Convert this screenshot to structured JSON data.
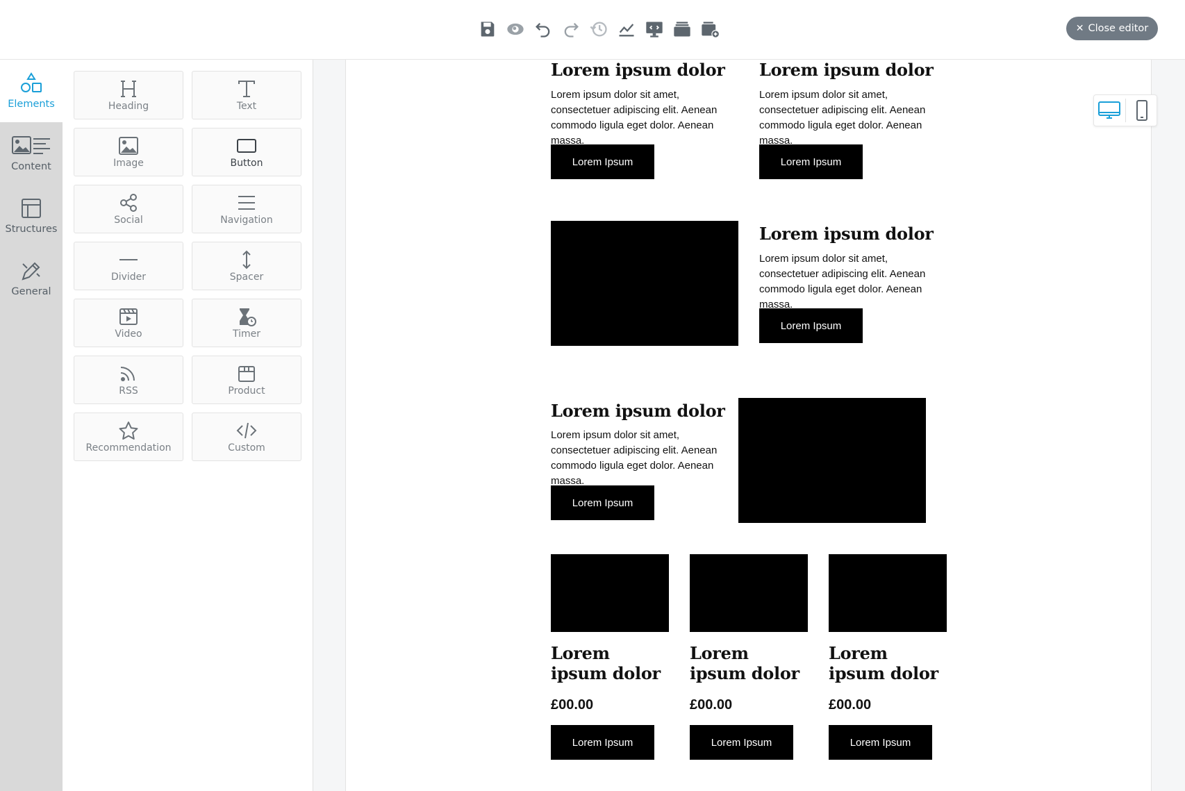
{
  "toolbar": {
    "tools": [
      "save-icon",
      "preview-icon",
      "undo-icon",
      "redo-icon",
      "history-icon",
      "stats-icon",
      "display-icon",
      "stack-icon",
      "add-template-icon"
    ],
    "close_label": "Close editor"
  },
  "rail": {
    "items": [
      {
        "label": "Elements",
        "icon": "shapes-icon"
      },
      {
        "label": "Content",
        "icon": "content-icon"
      },
      {
        "label": "Structures",
        "icon": "structures-icon"
      },
      {
        "label": "General",
        "icon": "general-icon"
      }
    ],
    "active": "Elements"
  },
  "elements": [
    {
      "label": "Heading"
    },
    {
      "label": "Text"
    },
    {
      "label": "Image"
    },
    {
      "label": "Button"
    },
    {
      "label": "Social"
    },
    {
      "label": "Navigation"
    },
    {
      "label": "Divider"
    },
    {
      "label": "Spacer"
    },
    {
      "label": "Video"
    },
    {
      "label": "Timer"
    },
    {
      "label": "RSS"
    },
    {
      "label": "Product"
    },
    {
      "label": "Recommendation"
    },
    {
      "label": "Custom"
    }
  ],
  "email": {
    "heading": "Lorem ipsum dolor",
    "body": "Lorem ipsum dolor sit amet, consectetuer adipiscing elit. Aenean commodo ligula eget dolor. Aenean massa.",
    "button": "Lorem Ipsum",
    "product_heading": "Lorem ipsum dolor",
    "price": "£00.00"
  },
  "colors": {
    "accent": "#1a9fd8",
    "rail_bg": "#d9d9d9",
    "close_button": "#707a84",
    "email_button": "#000000"
  }
}
